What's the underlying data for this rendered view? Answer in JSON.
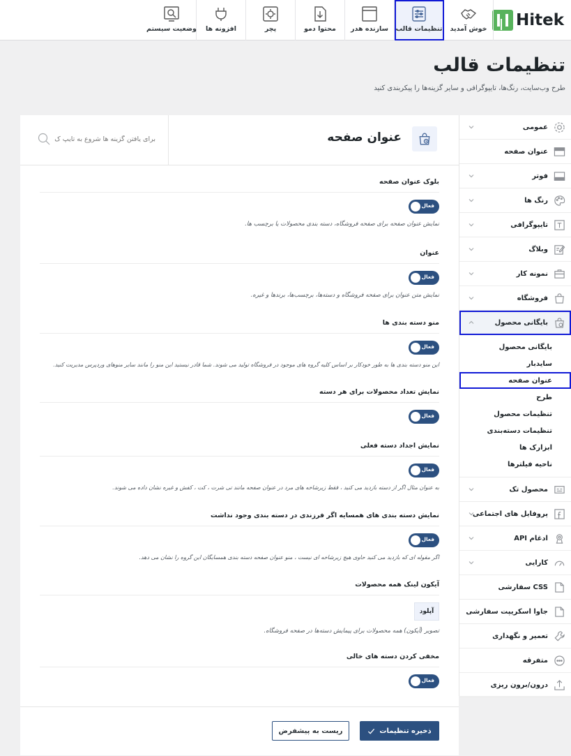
{
  "brand": {
    "name": "Hitek"
  },
  "tabs": [
    {
      "label": "خوش آمدید",
      "icon": "handshake-icon"
    },
    {
      "label": "تنظیمات قالب",
      "icon": "sliders-icon",
      "active": true
    },
    {
      "label": "سازنده هدر",
      "icon": "window-icon"
    },
    {
      "label": "محتوا دمو",
      "icon": "import-icon"
    },
    {
      "label": "پچر",
      "icon": "gear-box-icon"
    },
    {
      "label": "افزونه ها",
      "icon": "plug-icon"
    },
    {
      "label": "وضعیت سیستم",
      "icon": "monitor-search-icon"
    }
  ],
  "page": {
    "title": "تنظیمات قالب",
    "subtitle": "طرح وب‌سایت، رنگ‌ها، تایپوگرافی و سایر گزینه‌ها را پیکربندی کنید"
  },
  "sidebar": {
    "items": [
      {
        "label": "عمومی",
        "icon": "gear-icon",
        "chevron": true
      },
      {
        "label": "عنوان صفحه",
        "icon": "page-header-icon",
        "chevron": false
      },
      {
        "label": "فوتر",
        "icon": "footer-icon",
        "chevron": true
      },
      {
        "label": "رنگ ها",
        "icon": "palette-icon",
        "chevron": true
      },
      {
        "label": "تایپوگرافی",
        "icon": "text-icon",
        "chevron": true
      },
      {
        "label": "وبلاگ",
        "icon": "edit-icon",
        "chevron": true
      },
      {
        "label": "نمونه کار",
        "icon": "briefcase-icon",
        "chevron": true
      },
      {
        "label": "فروشگاه",
        "icon": "bag-icon",
        "chevron": true
      },
      {
        "label": "بایگانی محصول",
        "icon": "bag-clock-icon",
        "chevron": true,
        "open": true
      }
    ],
    "subitems": [
      "بایگانی محصول",
      "سایدبار",
      "عنوان صفحه",
      "طرح",
      "تنظیمات محصول",
      "تنظیمات دسته‌بندی",
      "ابزارک ها",
      "ناحیه فیلترها"
    ],
    "active_subitem": 2,
    "items_after": [
      {
        "label": "محصول تک",
        "icon": "product-icon",
        "chevron": true
      },
      {
        "label": "پروفایل های اجتماعی",
        "icon": "facebook-icon",
        "chevron": true
      },
      {
        "label": "ادغام API",
        "icon": "api-icon",
        "chevron": true
      },
      {
        "label": "کارایی",
        "icon": "gauge-icon",
        "chevron": true
      },
      {
        "label": "CSS سفارشی",
        "icon": "css-file-icon",
        "chevron": false
      },
      {
        "label": "جاوا اسکریپت سفارشی",
        "icon": "js-file-icon",
        "chevron": false
      },
      {
        "label": "تعمیر و نگهداری",
        "icon": "wrench-icon",
        "chevron": false
      },
      {
        "label": "متفرقه",
        "icon": "dots-icon",
        "chevron": false
      },
      {
        "label": "درون/برون ریزی",
        "icon": "upload-icon",
        "chevron": false
      }
    ]
  },
  "main": {
    "title": "عنوان صفحه",
    "search_placeholder": "برای یافتن گزینه ها شروع به تایپ ک",
    "toggle_label": "فعال",
    "fields": [
      {
        "label": "بلوک عنوان صفحه",
        "type": "toggle",
        "desc": "نمایش عنوان صفحه برای صفحه فروشگاه، دسته بندی محصولات یا برچسب ها."
      },
      {
        "label": "عنوان",
        "type": "toggle",
        "desc": "نمایش متن عنوان برای صفحه فروشگاه و دسته‌ها، برچسب‌ها، برندها و غیره."
      },
      {
        "label": "منو دسته بندی ها",
        "type": "toggle",
        "desc": "این منو دسته بندی ها به طور خودکار بر اساس کلیه گروه های موجود در فروشگاه تولید می شوند. شما قادر نیستید این منو را مانند سایر منوهای وردپرس مدیریت کنید."
      },
      {
        "label": "نمایش تعداد محصولات برای هر دسته",
        "type": "toggle",
        "desc": ""
      },
      {
        "label": "نمایش اجداد دسته فعلی",
        "type": "toggle",
        "desc": "به عنوان مثال اگر از دسته بازدید می کنید ، فقط زیرشاخه های مرد در عنوان صفحه مانند تی شرت ، کت ، کفش و غیره نشان داده می شوند."
      },
      {
        "label": "نمایش دسته بندی های همسایه اگر فرزندی در دسته بندی وجود نداشت",
        "type": "toggle",
        "desc": "اگر مقوله ای که بازدید می کنید حاوی هیچ زیرشاخه ای نیست ، منو عنوان صفحه دسته بندی همسایگان این گروه را نشان می دهد."
      },
      {
        "label": "آیکون لینک همه محصولات",
        "type": "upload",
        "button": "آپلود",
        "desc": "تصویر (آیکون) همه محصولات برای پیمایش دسته‌ها در صفحه فروشگاه."
      },
      {
        "label": "مخفی کردن دسته های خالی",
        "type": "toggle",
        "desc": ""
      }
    ],
    "save_label": "ذخیره تنظیمات",
    "reset_label": "ریست به پیشفرض"
  },
  "colors": {
    "accent": "#2c5080",
    "highlight": "#1019d6",
    "logo": "#58b35c"
  }
}
